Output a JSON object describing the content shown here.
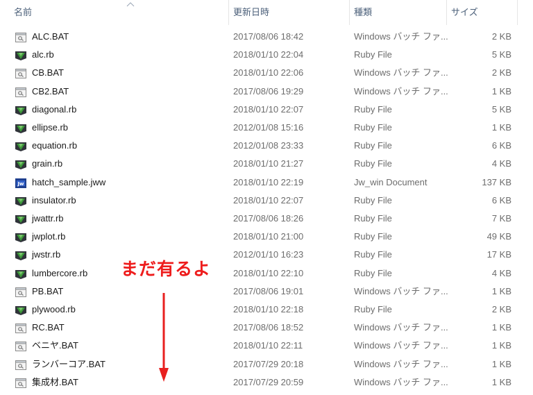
{
  "columns": {
    "name": "名前",
    "date": "更新日時",
    "type": "種類",
    "size": "サイズ"
  },
  "files": [
    {
      "name": "ALC.BAT",
      "date": "2017/08/06 18:42",
      "type": "Windows バッチ ファ...",
      "size": "2 KB",
      "icon": "batch-file-icon"
    },
    {
      "name": "alc.rb",
      "date": "2018/01/10 22:04",
      "type": "Ruby File",
      "size": "5 KB",
      "icon": "ruby-file-icon"
    },
    {
      "name": "CB.BAT",
      "date": "2018/01/10 22:06",
      "type": "Windows バッチ ファ...",
      "size": "2 KB",
      "icon": "batch-file-icon"
    },
    {
      "name": "CB2.BAT",
      "date": "2017/08/06 19:29",
      "type": "Windows バッチ ファ...",
      "size": "1 KB",
      "icon": "batch-file-icon"
    },
    {
      "name": "diagonal.rb",
      "date": "2018/01/10 22:07",
      "type": "Ruby File",
      "size": "5 KB",
      "icon": "ruby-file-icon"
    },
    {
      "name": "ellipse.rb",
      "date": "2012/01/08 15:16",
      "type": "Ruby File",
      "size": "1 KB",
      "icon": "ruby-file-icon"
    },
    {
      "name": "equation.rb",
      "date": "2012/01/08 23:33",
      "type": "Ruby File",
      "size": "6 KB",
      "icon": "ruby-file-icon"
    },
    {
      "name": "grain.rb",
      "date": "2018/01/10 21:27",
      "type": "Ruby File",
      "size": "4 KB",
      "icon": "ruby-file-icon"
    },
    {
      "name": "hatch_sample.jww",
      "date": "2018/01/10 22:19",
      "type": "Jw_win Document",
      "size": "137 KB",
      "icon": "jww-file-icon"
    },
    {
      "name": "insulator.rb",
      "date": "2018/01/10 22:07",
      "type": "Ruby File",
      "size": "6 KB",
      "icon": "ruby-file-icon"
    },
    {
      "name": "jwattr.rb",
      "date": "2017/08/06 18:26",
      "type": "Ruby File",
      "size": "7 KB",
      "icon": "ruby-file-icon"
    },
    {
      "name": "jwplot.rb",
      "date": "2018/01/10 21:00",
      "type": "Ruby File",
      "size": "49 KB",
      "icon": "ruby-file-icon"
    },
    {
      "name": "jwstr.rb",
      "date": "2012/01/10 16:23",
      "type": "Ruby File",
      "size": "17 KB",
      "icon": "ruby-file-icon"
    },
    {
      "name": "lumbercore.rb",
      "date": "2018/01/10 22:10",
      "type": "Ruby File",
      "size": "4 KB",
      "icon": "ruby-file-icon"
    },
    {
      "name": "PB.BAT",
      "date": "2017/08/06 19:01",
      "type": "Windows バッチ ファ...",
      "size": "1 KB",
      "icon": "batch-file-icon"
    },
    {
      "name": "plywood.rb",
      "date": "2018/01/10 22:18",
      "type": "Ruby File",
      "size": "2 KB",
      "icon": "ruby-file-icon"
    },
    {
      "name": "RC.BAT",
      "date": "2017/08/06 18:52",
      "type": "Windows バッチ ファ...",
      "size": "1 KB",
      "icon": "batch-file-icon"
    },
    {
      "name": "ベニヤ.BAT",
      "date": "2018/01/10 22:11",
      "type": "Windows バッチ ファ...",
      "size": "1 KB",
      "icon": "batch-file-icon"
    },
    {
      "name": "ランバーコア.BAT",
      "date": "2017/07/29 20:18",
      "type": "Windows バッチ ファ...",
      "size": "1 KB",
      "icon": "batch-file-icon"
    },
    {
      "name": "集成材.BAT",
      "date": "2017/07/29 20:59",
      "type": "Windows バッチ ファ...",
      "size": "1 KB",
      "icon": "batch-file-icon"
    }
  ],
  "annotation": {
    "text": "まだ有るよ",
    "color": "#ee1c1c"
  },
  "colors": {
    "header_text": "#4c607a",
    "name_text": "#1a1a1a",
    "meta_text": "#6d6d6d"
  }
}
